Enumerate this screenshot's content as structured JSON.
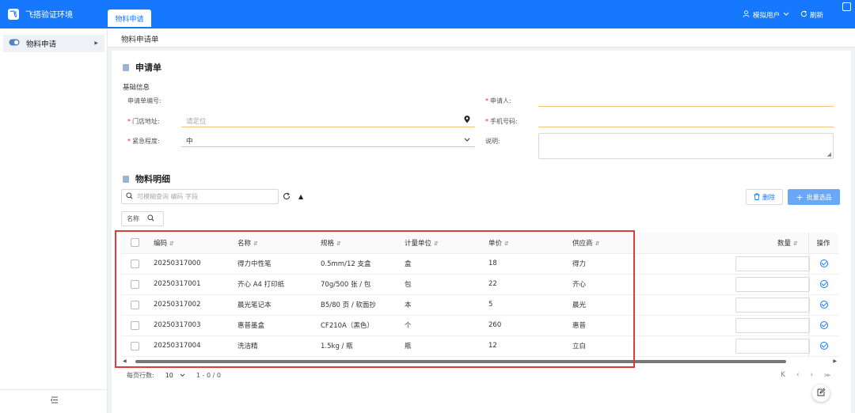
{
  "app": {
    "title": "飞搭验证环境",
    "logo": "飞"
  },
  "top_tabs": [
    {
      "label": "物料申请"
    }
  ],
  "top_right": {
    "user_label": "模拟用户",
    "refresh_label": "刷新"
  },
  "sidebar": {
    "items": [
      {
        "label": "物料申请"
      }
    ]
  },
  "breadcrumb": "物料申请单",
  "form": {
    "section_title": "申请单",
    "sub_title": "基础信息",
    "fields": {
      "order_no": {
        "label": "申请单编号:",
        "value": ""
      },
      "applicant": {
        "label": "申请人:",
        "value": ""
      },
      "store_address": {
        "label": "门店地址:",
        "placeholder": "请定位"
      },
      "phone": {
        "label": "手机号码:",
        "value": ""
      },
      "urgency": {
        "label": "紧急程度:",
        "value": "中"
      },
      "remark": {
        "label": "说明:",
        "value": ""
      }
    }
  },
  "detail": {
    "section_title": "物料明细",
    "search_placeholder": "可模糊查询 编码 字段",
    "delete_label": "删除",
    "batch_label": "批量选品",
    "column_chip": "名称"
  },
  "table": {
    "headers": {
      "code": "编码",
      "name": "名称",
      "spec": "规格",
      "unit": "计量单位",
      "price": "单价",
      "supplier": "供应商",
      "quantity": "数量",
      "ops": "操作"
    },
    "rows": [
      {
        "code": "20250317000",
        "name": "得力中性笔",
        "spec": "0.5mm/12 支盒",
        "unit": "盒",
        "price": "18",
        "supplier": "得力"
      },
      {
        "code": "20250317001",
        "name": "齐心 A4 打印纸",
        "spec": "70g/500 张 / 包",
        "unit": "包",
        "price": "22",
        "supplier": "齐心"
      },
      {
        "code": "20250317002",
        "name": "晨光笔记本",
        "spec": "B5/80 页 / 软面抄",
        "unit": "本",
        "price": "5",
        "supplier": "晨光"
      },
      {
        "code": "20250317003",
        "name": "惠普墨盒",
        "spec": "CF210A（黑色）",
        "unit": "个",
        "price": "260",
        "supplier": "惠普"
      },
      {
        "code": "20250317004",
        "name": "洗洁精",
        "spec": "1.5kg / 瓶",
        "unit": "瓶",
        "price": "12",
        "supplier": "立白"
      }
    ]
  },
  "pager": {
    "rows_per_page_label": "每页行数:",
    "rows_per_page": "10",
    "range": "1 - 0 / 0"
  },
  "icons": [
    "user-icon",
    "refresh-icon",
    "location-pin-icon",
    "chevron-down-icon",
    "search-icon",
    "check-circle-icon",
    "ban-icon",
    "trash-icon",
    "plus-icon",
    "edit-icon",
    "doc-icon"
  ],
  "colors": {
    "brand": "#1677ff",
    "required": "#f5222d",
    "highlight": "#e03b3b",
    "field_underline": "#f5c37a"
  }
}
